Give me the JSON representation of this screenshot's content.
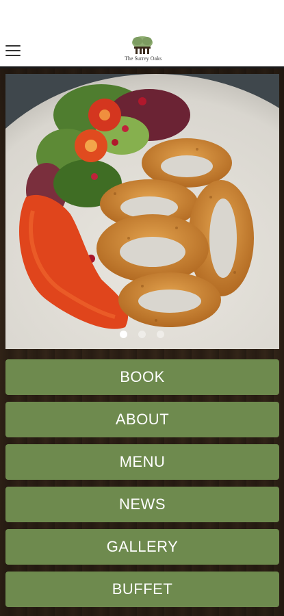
{
  "header": {
    "logo_text": "The Surrey Oaks",
    "menu_icon": "hamburger-menu-icon"
  },
  "carousel": {
    "slide_count": 3,
    "active_index": 0,
    "image_description_icon": "food-photo"
  },
  "nav": [
    {
      "label": "BOOK"
    },
    {
      "label": "ABOUT"
    },
    {
      "label": "MENU"
    },
    {
      "label": "NEWS"
    },
    {
      "label": "GALLERY"
    },
    {
      "label": "BUFFET"
    }
  ],
  "colors": {
    "button_green": "#6e8a4e",
    "button_text": "#ffffff",
    "header_bg": "#ffffff",
    "wood_bg": "#33261a"
  }
}
